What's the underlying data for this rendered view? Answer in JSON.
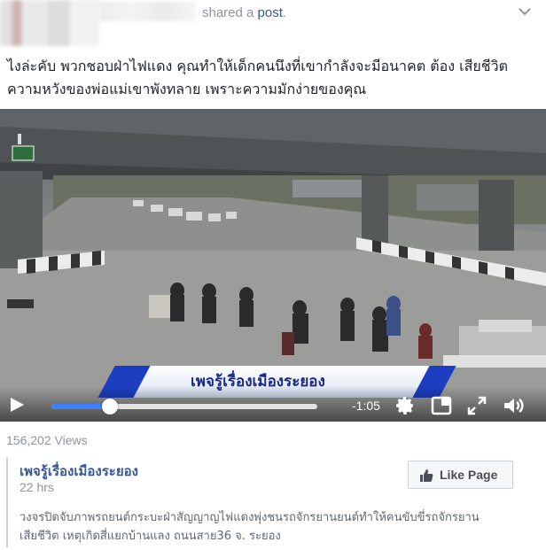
{
  "header": {
    "shared_text": "shared a ",
    "post_link": "post",
    "period": "."
  },
  "caption": {
    "line1": "ไงล่ะคับ พวกชอบฝ่าไฟแดง คุณทำให้เด็กคนนึงที่เขากำลังจะมีอนาคต ต้อง เสียชีวิต",
    "line2": "ความหวังของพ่อแม่เขาพังทลาย เพราะความมักง่ายของคุณ"
  },
  "video": {
    "lower_third_text": "เพจรู้เรื่องเมืองระยอง",
    "time_remaining": "-1:05",
    "progress": 0.22,
    "buffered": 1.0,
    "icons": [
      "play-icon",
      "gear-icon",
      "picture-in-picture-icon",
      "fullscreen-icon",
      "volume-icon"
    ],
    "accent_color": "#4080ff"
  },
  "stats": {
    "views": "156,202 Views"
  },
  "attachment": {
    "page_name": "เพจรู้เรื่องเมืองระยอง",
    "time": "22 hrs",
    "like_button": "Like Page",
    "description_line1": "วงจรปิดจับภาพรถยนต์กระบะฝ่าสัญญาญไฟแดงพุ่งชนรถจักรยานยนต์ทำให้คนขับขี่รถจักรยาน",
    "description_line2": "เสียชีวิต เหตุเกิดสี่แยกบ้านแลง ถนนสาย36 จ. ระยอง"
  }
}
